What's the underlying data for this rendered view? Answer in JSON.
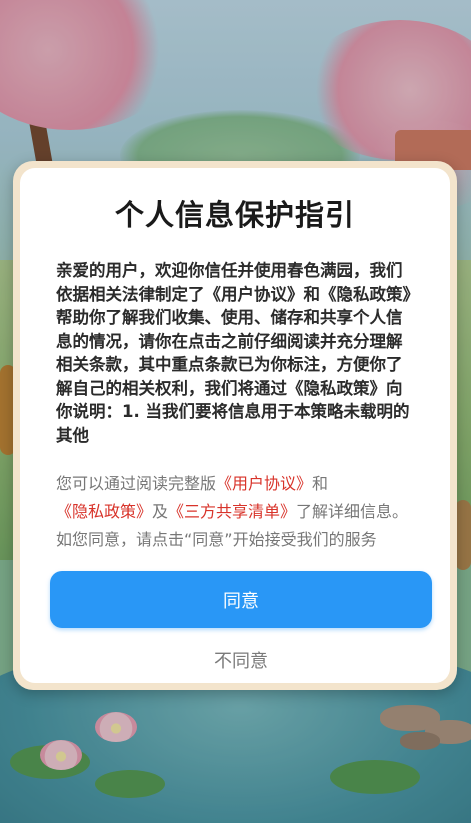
{
  "dialog": {
    "title": "个人信息保护指引",
    "body": "亲爱的用户，欢迎你信任并使用春色满园，我们依据相关法律制定了《用户协议》和《隐私政策》帮助你了解我们收集、使用、储存和共享个人信息的情况，请你在点击之前仔细阅读并充分理解相关条款，其中重点条款已为你标注，方便你了解自己的相关权利，我们将通过《隐私政策》向你说明：1. 当我们要将信息用于本策略未载明的其他",
    "summary": {
      "prefix": "您可以通过阅读完整版",
      "user_agreement_link": "《用户协议》",
      "and": "和",
      "privacy_policy_link": "《隐私政策》",
      "and2": "及",
      "third_party_link": "《三方共享清单》",
      "suffix": "了解详细信息。如您同意，请点击“同意”开始接受我们的服务"
    },
    "agree_label": "同意",
    "disagree_label": "不同意"
  },
  "colors": {
    "accent": "#2997f6",
    "link": "#d8332a",
    "dialog_frame": "#f3e4cc"
  }
}
